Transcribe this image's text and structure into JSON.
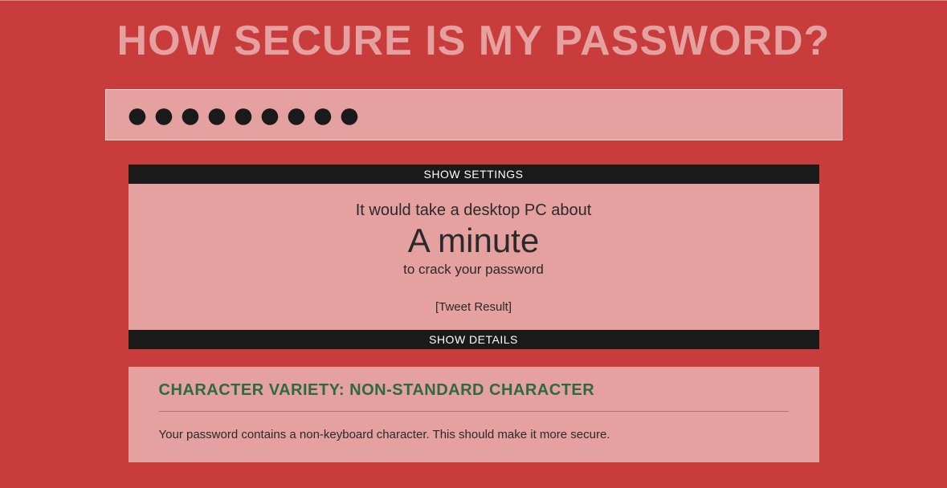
{
  "title": "HOW SECURE IS MY PASSWORD?",
  "password_value": "●●●●●●●●●",
  "settings_label": "SHOW SETTINGS",
  "details_label": "SHOW DETAILS",
  "result": {
    "line1": "It would take a desktop PC about",
    "time": "A minute",
    "line2": "to crack your password",
    "tweet": "[Tweet Result]"
  },
  "info": {
    "heading": "CHARACTER VARIETY: NON-STANDARD CHARACTER",
    "text": "Your password contains a non-keyboard character. This should make it more secure."
  }
}
